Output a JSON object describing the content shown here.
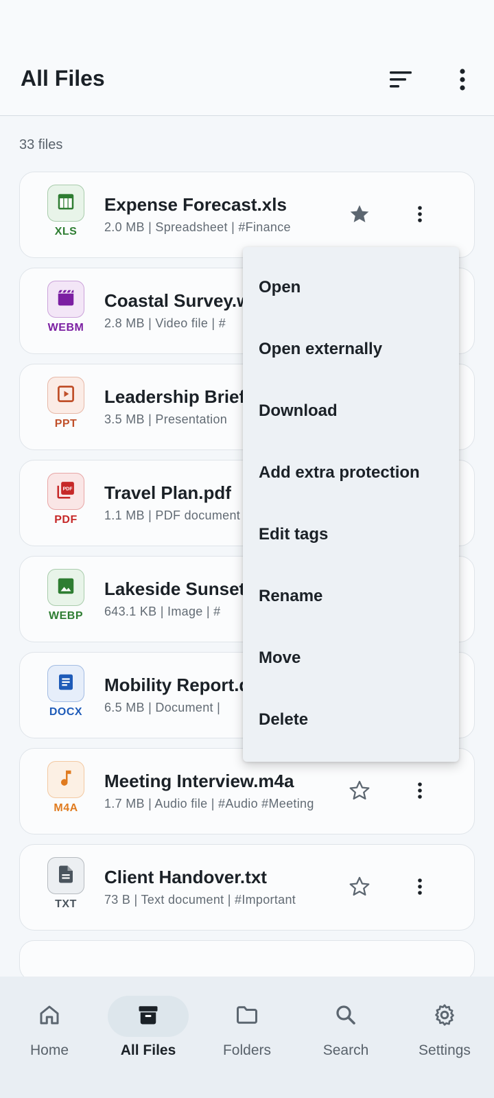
{
  "header": {
    "title": "All Files"
  },
  "summary": {
    "count": "33 files"
  },
  "files": [
    {
      "name": "Expense Forecast.xls",
      "meta": "2.0 MB | Spreadsheet | #Finance",
      "type": "XLS",
      "icon": "spreadsheet-icon",
      "color": "#2e7d32",
      "bg": "#e8f4e9",
      "starred": true
    },
    {
      "name": "Coastal Survey.webm",
      "meta": "2.8 MB | Video file | #",
      "type": "WEBM",
      "icon": "video-icon",
      "color": "#7b1fa2",
      "bg": "#f3e6f7",
      "starred": false
    },
    {
      "name": "Leadership Brief",
      "meta": "3.5 MB | Presentation",
      "type": "PPT",
      "icon": "presentation-icon",
      "color": "#c0502a",
      "bg": "#fbece6",
      "starred": false
    },
    {
      "name": "Travel Plan.pdf",
      "meta": "1.1 MB | PDF document",
      "type": "PDF",
      "icon": "pdf-icon",
      "color": "#c62828",
      "bg": "#fae6e6",
      "starred": false
    },
    {
      "name": "Lakeside Sunset",
      "meta": "643.1 KB | Image | #",
      "type": "WEBP",
      "icon": "image-icon",
      "color": "#2e7d32",
      "bg": "#e8f4e9",
      "starred": false
    },
    {
      "name": "Mobility Report.d",
      "meta": "6.5 MB | Document |",
      "type": "DOCX",
      "icon": "document-icon",
      "color": "#1e5bb8",
      "bg": "#e6eefa",
      "starred": false
    },
    {
      "name": "Meeting Interview.m4a",
      "meta": "1.7 MB | Audio file | #Audio  #Meeting",
      "type": "M4A",
      "icon": "music-note-icon",
      "color": "#e07b1f",
      "bg": "#fcf0e4",
      "starred": false
    },
    {
      "name": "Client Handover.txt",
      "meta": "73 B | Text document | #Important",
      "type": "TXT",
      "icon": "text-file-icon",
      "color": "#4a545d",
      "bg": "#eceff2",
      "starred": false
    }
  ],
  "menu": {
    "items": [
      "Open",
      "Open externally",
      "Download",
      "Add extra protection",
      "Edit tags",
      "Rename",
      "Move",
      "Delete"
    ]
  },
  "nav": {
    "items": [
      {
        "label": "Home",
        "icon": "home-icon",
        "active": false
      },
      {
        "label": "All Files",
        "icon": "archive-icon",
        "active": true
      },
      {
        "label": "Folders",
        "icon": "folder-icon",
        "active": false
      },
      {
        "label": "Search",
        "icon": "search-icon",
        "active": false
      },
      {
        "label": "Settings",
        "icon": "gear-icon",
        "active": false
      }
    ]
  }
}
